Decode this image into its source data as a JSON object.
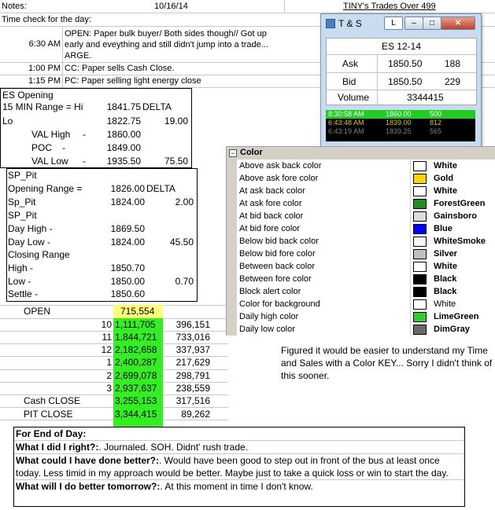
{
  "header": {
    "notes_label": "Notes:",
    "date": "10/16/14",
    "title": "TINY's Trades Over 499",
    "time_check": "Time check for the day:"
  },
  "time_log": [
    {
      "time": "6:30 AM",
      "lines": [
        "OPEN: Paper bulk buyer/ Both sides though// Got up",
        "early and eveything and still didn't jump into a trade...",
        "ARGE."
      ]
    },
    {
      "time": "1:00 PM",
      "lines": [
        "CC: Paper sells Cash Close."
      ]
    },
    {
      "time": "1:15 PM",
      "lines": [
        "PC: Paper selling light energy close"
      ]
    }
  ],
  "es_box": {
    "title": "ES Opening",
    "range_label": "15 MIN Range = Hi",
    "range_value": "1841.75",
    "range_unit": "DELTA",
    "lo_label": "Lo",
    "lo_value": "1822.75",
    "lo_delta": "19.00",
    "val_high_label": "VAL High",
    "val_high_value": "1860.00",
    "poc_label": "POC",
    "poc_value": "1849.00",
    "val_low_label": "VAL Low",
    "val_low_value": "1935.50",
    "val_low_delta": "75.50",
    "dash": "-"
  },
  "sp_box": {
    "title": "SP_Pit",
    "opening_range_label": "Opening Range =",
    "opening_range_value": "1826.00",
    "opening_range_unit": "DELTA",
    "sp_pit_label": "Sp_Pit",
    "sp_pit_value": "1824.00",
    "sp_pit_delta": "2.00",
    "sp_pit2_label": "SP_Pit",
    "day_high_label": "Day High -",
    "day_high_value": "1869.50",
    "day_low_label": "Day Low -",
    "day_low_value": "1824.00",
    "day_low_delta": "45.50",
    "closing_range_label": "Closing Range",
    "high_label": "High -",
    "high_value": "1850.70",
    "low_label": "Low -",
    "low_value": "1850.00",
    "low_delta": "0.70",
    "settle_label": "Settle -",
    "settle_value": "1850.60"
  },
  "volume_table": {
    "open_label": "OPEN",
    "open_value": "715,554",
    "rows": [
      {
        "hour": "10",
        "cum": "1,111,705",
        "vol": "396,151"
      },
      {
        "hour": "11",
        "cum": "1,844,721",
        "vol": "733,016"
      },
      {
        "hour": "12",
        "cum": "2,182,658",
        "vol": "337,937"
      },
      {
        "hour": "1",
        "cum": "2,400,287",
        "vol": "217,629"
      },
      {
        "hour": "2",
        "cum": "2,699,078",
        "vol": "298,791"
      },
      {
        "hour": "3",
        "cum": "2,937,637",
        "vol": "238,559"
      }
    ],
    "cash_close_label": "Cash CLOSE",
    "cash_close_cum": "3,255,153",
    "cash_close_vol": "317,516",
    "pit_close_label": "PIT CLOSE",
    "pit_close_cum": "3,344,415",
    "pit_close_vol": "89,262"
  },
  "ts_window": {
    "title": "T & S",
    "btn_l": "L",
    "symbol": "ES 12-14",
    "ask_label": "Ask",
    "ask_price": "1850.50",
    "ask_size": "188",
    "bid_label": "Bid",
    "bid_price": "1850.50",
    "bid_size": "229",
    "volume_label": "Volume",
    "volume_value": "3344415",
    "trades": [
      {
        "time": "8:30:58 AM",
        "price": "1860.00",
        "size": "500",
        "bg": "#22cc22",
        "fg": "#ffffff"
      },
      {
        "time": "6:43:48 AM",
        "price": "1839.00",
        "size": "812",
        "bg": "#000000",
        "fg": "#e6c200"
      },
      {
        "time": "6:43:19 AM",
        "price": "1839.25",
        "size": "565",
        "bg": "#000000",
        "fg": "#808080"
      }
    ]
  },
  "color_panel": {
    "header": "Color",
    "rows": [
      {
        "label": "Above ask back color",
        "value": "White",
        "color": "#ffffff",
        "bold": true
      },
      {
        "label": "Above ask fore color",
        "value": "Gold",
        "color": "#ffd700",
        "bold": true
      },
      {
        "label": "At ask back color",
        "value": "White",
        "color": "#ffffff",
        "bold": true
      },
      {
        "label": "At ask fore color",
        "value": "ForestGreen",
        "color": "#228b22",
        "bold": true
      },
      {
        "label": "At bid back color",
        "value": "Gainsboro",
        "color": "#dcdcdc",
        "bold": true
      },
      {
        "label": "At bid fore color",
        "value": "Blue",
        "color": "#0000ff",
        "bold": true
      },
      {
        "label": "Below bid back color",
        "value": "WhiteSmoke",
        "color": "#f5f5f5",
        "bold": true
      },
      {
        "label": "Below bid fore color",
        "value": "Silver",
        "color": "#c0c0c0",
        "bold": true
      },
      {
        "label": "Between back color",
        "value": "White",
        "color": "#ffffff",
        "bold": true
      },
      {
        "label": "Between fore color",
        "value": "Black",
        "color": "#000000",
        "bold": true
      },
      {
        "label": "Block alert color",
        "value": "Black",
        "color": "#000000",
        "bold": true
      },
      {
        "label": "Color for background",
        "value": "White",
        "color": "#ffffff",
        "bold": false
      },
      {
        "label": "Daily high color",
        "value": "LimeGreen",
        "color": "#32cd32",
        "bold": true
      },
      {
        "label": "Daily low color",
        "value": "DimGray",
        "color": "#696969",
        "bold": true
      }
    ]
  },
  "key_note": "Figured it would be easier to understand my Time and Sales with a Color KEY... Sorry I didn't think of this sooner.",
  "end_of_day": {
    "title": "For End of Day:",
    "q1": "What I did I right?:",
    "a1": ".  Journaled.  SOH. Didnt' rush trade.",
    "q2": "What could I have done better?:",
    "a2": ".  Would have been good to step out in front of the bus at least once today.  Less timid in my approach would be better.  Maybe just to take a quick loss or win to start the day.",
    "q3": "What will I do better tomorrow?:",
    "a3": ".  At this moment in time I don't know."
  }
}
